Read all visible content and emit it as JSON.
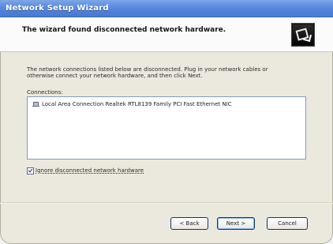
{
  "window": {
    "title": "Network Setup Wizard"
  },
  "header": {
    "text": "The wizard found disconnected network hardware."
  },
  "instruction": {
    "line1": "The network connections listed below are disconnected. Plug in your network cables or",
    "line2": "otherwise connect your network hardware, and then click Next."
  },
  "connections": {
    "label": "Connections:",
    "items": [
      {
        "label": "Local Area Connection   Realtek RTL8139 Family PCI Fast Ethernet NIC"
      }
    ]
  },
  "options": {
    "ignore_disconnected_label": "Ignore disconnected network hardware",
    "ignore_disconnected_checked": true
  },
  "buttons": {
    "back": "< Back",
    "next": "Next >",
    "cancel": "Cancel"
  }
}
